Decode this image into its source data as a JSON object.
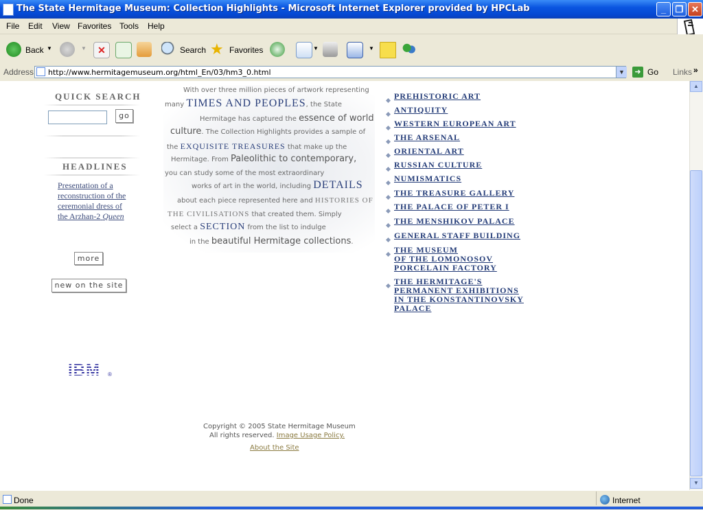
{
  "window": {
    "title": "The State Hermitage Museum: Collection Highlights - Microsoft Internet Explorer provided by HPCLab",
    "minimize": "_",
    "maximize": "❐",
    "close": "✕"
  },
  "menu": [
    "File",
    "Edit",
    "View",
    "Favorites",
    "Tools",
    "Help"
  ],
  "toolbar": {
    "back": "Back",
    "search": "Search",
    "favorites": "Favorites"
  },
  "address": {
    "label": "Address",
    "url": "http://www.hermitagemuseum.org/html_En/03/hm3_0.html",
    "go": "Go",
    "links": "Links"
  },
  "sidebar": {
    "quick_search": "QUICK SEARCH",
    "go_button": "go",
    "headlines": "HEADLINES",
    "headline_text": "Presentation of a reconstruction of the ceremonial dress of the Arzhan-2",
    "headline_italic": "Queen",
    "more": "more",
    "new_on_site": "new on the site"
  },
  "intro": {
    "l1": "With over three million pieces of artwork representing",
    "l2a": "many",
    "l2b": "TIMES AND PEOPLES",
    "l2c": ", the State",
    "l3a": "Hermitage has captured the",
    "l3b": "essence of world",
    "l4a": "culture",
    "l4b": ". The Collection Highlights provides a sample of",
    "l5a": "the",
    "l5b": "EXQUISITE TREASURES",
    "l5c": "that make up the",
    "l6a": "Hermitage. From",
    "l6b": "Paleolithic to contemporary",
    "l6c": ",",
    "l7": "you can study some of the most extraordinary",
    "l8a": "works of art in the world, including",
    "l8b": "DETAILS",
    "l9a": "about each piece represented here and",
    "l9b": "HISTORIES OF",
    "l10a": "THE CIVILISATIONS",
    "l10b": "that created them. Simply",
    "l11a": "select a",
    "l11b": "SECTION",
    "l11c": "from the list to indulge",
    "l12a": "in the",
    "l12b": "beautiful Hermitage collections",
    "l12c": "."
  },
  "categories": [
    "PREHISTORIC ART",
    "ANTIQUITY",
    "WESTERN EUROPEAN ART",
    "THE ARSENAL",
    "ORIENTAL ART",
    "RUSSIAN CULTURE",
    "NUMISMATICS",
    "THE TREASURE GALLERY",
    "THE PALACE OF PETER I",
    "THE MENSHIKOV PALACE",
    "GENERAL STAFF BUILDING",
    "THE MUSEUM",
    "OF THE LOMONOSOV",
    "PORCELAIN FACTORY",
    "THE HERMITAGE'S",
    "PERMANENT EXHIBITIONS",
    "IN THE KONSTANTINOVSKY",
    "PALACE"
  ],
  "logo": "IBM",
  "logo_mark": "®",
  "footer": {
    "copyright": "Copyright © 2005 State Hermitage Museum",
    "rights": "All rights reserved.",
    "policy": "Image Usage Policy.",
    "about": "About the Site"
  },
  "status": {
    "text": "Done",
    "zone": "Internet"
  },
  "colors": {
    "titlebar": "#0a55e0",
    "link": "#243c78",
    "footer_link": "#8a7a40"
  }
}
